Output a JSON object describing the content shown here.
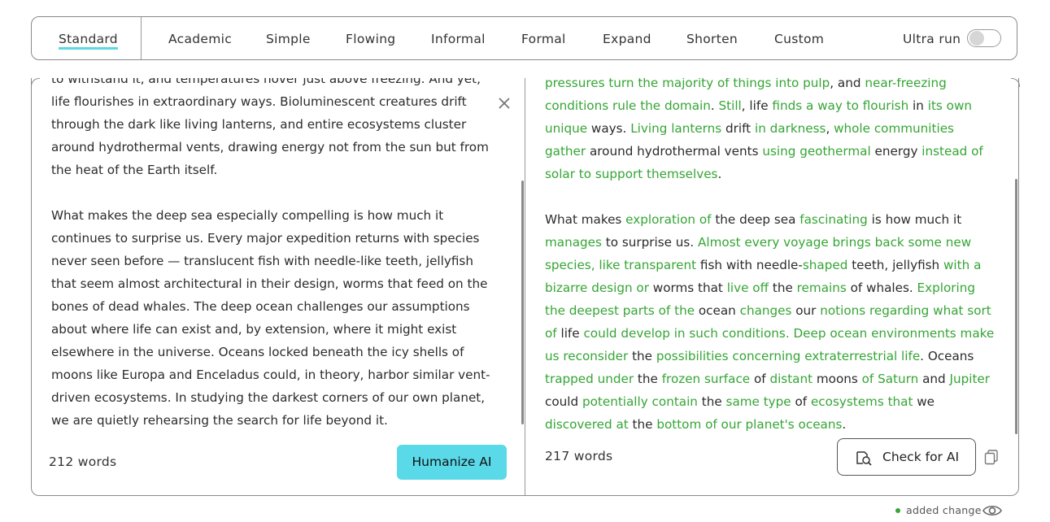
{
  "modes": {
    "items": [
      "Standard",
      "Academic",
      "Simple",
      "Flowing",
      "Informal",
      "Formal",
      "Expand",
      "Shorten",
      "Custom"
    ],
    "active": "Standard",
    "ultra_label": "Ultra run",
    "ultra_on": false
  },
  "input": {
    "paragraphs": [
      "to withstand it, and temperatures hover just above freezing. And yet, life flourishes in extraordinary ways. Bioluminescent creatures drift through the dark like living lanterns, and entire ecosystems cluster around hydrothermal vents, drawing energy not from the sun but from the heat of the Earth itself.",
      "What makes the deep sea especially compelling is how much it continues to surprise us. Every major expedition returns with species never seen before — translucent fish with needle-like teeth, jellyfish that seem almost architectural in their design, worms that feed on the bones of dead whales. The deep ocean challenges our assumptions about where life can exist and, by extension, where it might exist elsewhere in the universe. Oceans locked beneath the icy shells of moons like Europa and Enceladus could, in theory, harbor similar vent-driven ecosystems. In studying the darkest corners of our own planet, we are quietly rehearsing the search for life beyond it."
    ],
    "word_count": "212 words",
    "humanize_label": "Humanize AI",
    "close_icon": "close-icon"
  },
  "output": {
    "paragraphs": [
      [
        {
          "t": "pressures turn the majority of things into pulp",
          "c": true
        },
        {
          "t": ", and ",
          "c": false
        },
        {
          "t": "near-freezing conditions rule the domain",
          "c": true
        },
        {
          "t": ". ",
          "c": false
        },
        {
          "t": "Still",
          "c": true
        },
        {
          "t": ", life ",
          "c": false
        },
        {
          "t": "finds a way to flourish",
          "c": true
        },
        {
          "t": " in ",
          "c": false
        },
        {
          "t": "its own unique",
          "c": true
        },
        {
          "t": " ways. ",
          "c": false
        },
        {
          "t": "Living lanterns",
          "c": true
        },
        {
          "t": " drift ",
          "c": false
        },
        {
          "t": "in darkness",
          "c": true
        },
        {
          "t": ", ",
          "c": false
        },
        {
          "t": "whole communities gather",
          "c": true
        },
        {
          "t": " around hydrothermal vents ",
          "c": false
        },
        {
          "t": "using geothermal",
          "c": true
        },
        {
          "t": " energy ",
          "c": false
        },
        {
          "t": "instead of solar to support themselves",
          "c": true
        },
        {
          "t": ".",
          "c": false
        }
      ],
      [
        {
          "t": "What makes ",
          "c": false
        },
        {
          "t": "exploration of",
          "c": true
        },
        {
          "t": " the deep sea ",
          "c": false
        },
        {
          "t": "fascinating",
          "c": true
        },
        {
          "t": " is how much it ",
          "c": false
        },
        {
          "t": "manages",
          "c": true
        },
        {
          "t": " to surprise us. ",
          "c": false
        },
        {
          "t": "Almost every voyage brings back some new species, like transparent",
          "c": true
        },
        {
          "t": " fish with needle-",
          "c": false
        },
        {
          "t": "shaped",
          "c": true
        },
        {
          "t": " teeth, jellyfish ",
          "c": false
        },
        {
          "t": "with a bizarre design or",
          "c": true
        },
        {
          "t": " worms that ",
          "c": false
        },
        {
          "t": "live off",
          "c": true
        },
        {
          "t": " the ",
          "c": false
        },
        {
          "t": "remains",
          "c": true
        },
        {
          "t": " of whales. ",
          "c": false
        },
        {
          "t": "Exploring the deepest parts of the",
          "c": true
        },
        {
          "t": " ocean ",
          "c": false
        },
        {
          "t": "changes",
          "c": true
        },
        {
          "t": " our ",
          "c": false
        },
        {
          "t": "notions regarding what sort of",
          "c": true
        },
        {
          "t": " life ",
          "c": false
        },
        {
          "t": "could develop in such conditions. Deep ocean environments make us reconsider",
          "c": true
        },
        {
          "t": " the ",
          "c": false
        },
        {
          "t": "possibilities concerning extraterrestrial life",
          "c": true
        },
        {
          "t": ". Oceans ",
          "c": false
        },
        {
          "t": "trapped under",
          "c": true
        },
        {
          "t": " the ",
          "c": false
        },
        {
          "t": "frozen surface",
          "c": true
        },
        {
          "t": " of ",
          "c": false
        },
        {
          "t": "distant",
          "c": true
        },
        {
          "t": " moons ",
          "c": false
        },
        {
          "t": "of Saturn",
          "c": true
        },
        {
          "t": " and ",
          "c": false
        },
        {
          "t": "Jupiter",
          "c": true
        },
        {
          "t": " could ",
          "c": false
        },
        {
          "t": "potentially contain",
          "c": true
        },
        {
          "t": " the ",
          "c": false
        },
        {
          "t": "same type",
          "c": true
        },
        {
          "t": " of ",
          "c": false
        },
        {
          "t": "ecosystems that",
          "c": true
        },
        {
          "t": " we ",
          "c": false
        },
        {
          "t": "discovered at",
          "c": true
        },
        {
          "t": " the ",
          "c": false
        },
        {
          "t": "bottom of our planet's oceans",
          "c": true
        },
        {
          "t": ".",
          "c": false
        }
      ]
    ],
    "word_count": "217 words",
    "check_label": "Check for AI",
    "check_icon": "magnifier-ai-icon",
    "copy_icon": "copy-icon"
  },
  "legend": {
    "label": "added change",
    "dot_color": "#35a535",
    "eye_icon": "eye-icon"
  },
  "colors": {
    "accent": "#5ad9e9",
    "change_text": "#35a535"
  }
}
